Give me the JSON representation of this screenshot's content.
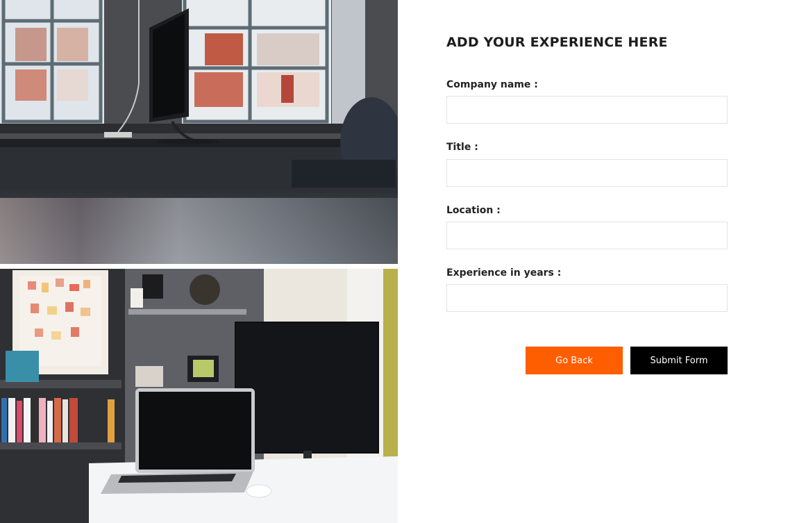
{
  "form": {
    "title": "ADD YOUR EXPERIENCE HERE",
    "fields": [
      {
        "label": "Company name :",
        "value": "",
        "placeholder": ""
      },
      {
        "label": "Title :",
        "value": "",
        "placeholder": ""
      },
      {
        "label": "Location :",
        "value": "",
        "placeholder": ""
      },
      {
        "label": "Experience in years :",
        "value": "",
        "placeholder": ""
      }
    ],
    "buttons": {
      "go_back": "Go Back",
      "submit": "Submit Form"
    }
  },
  "colors": {
    "accent": "#ff5e00",
    "submit_bg": "#000000",
    "title_text": "#1e1e1e"
  }
}
